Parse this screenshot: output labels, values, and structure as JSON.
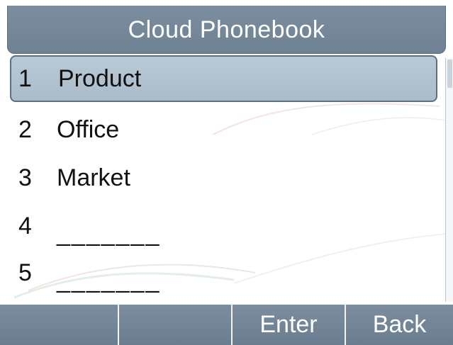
{
  "title": "Cloud  Phonebook",
  "items": [
    {
      "number": "1",
      "label": "Product",
      "selected": true
    },
    {
      "number": "2",
      "label": "Office",
      "selected": false
    },
    {
      "number": "3",
      "label": "Market",
      "selected": false
    },
    {
      "number": "4",
      "label": "_______",
      "selected": false
    },
    {
      "number": "5",
      "label": "_______",
      "selected": false
    }
  ],
  "softkeys": [
    "",
    "",
    "Enter",
    "Back"
  ],
  "colors": {
    "bar": "#7387999",
    "selection": "#b1c3d1",
    "text": "#111111"
  }
}
